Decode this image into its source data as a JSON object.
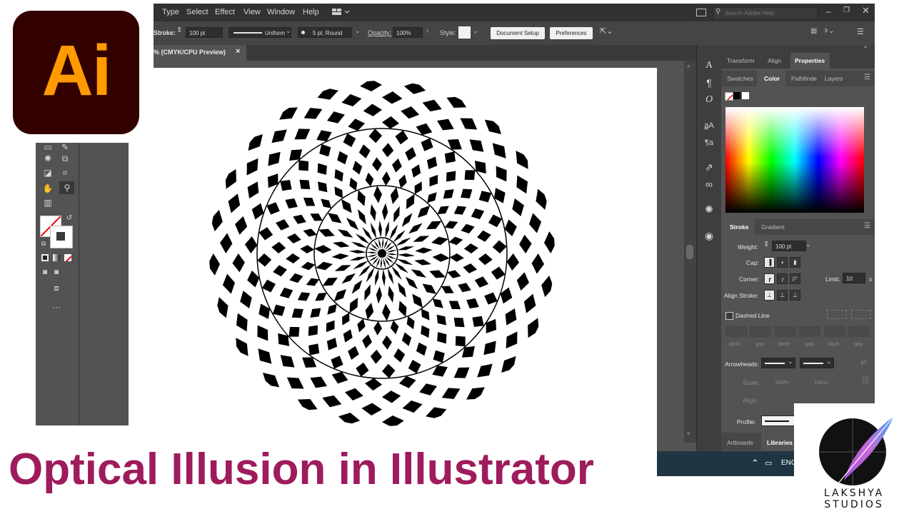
{
  "menu": [
    "Type",
    "Select",
    "Effect",
    "View",
    "Window",
    "Help"
  ],
  "search": {
    "placeholder": "Search Adobe Help"
  },
  "control_bar": {
    "stroke_label": "Stroke:",
    "stroke_value": "100 pt",
    "stroke_profile": "Uniform",
    "brush": "5 pt. Round",
    "opacity_label": "Opacity:",
    "opacity_value": "100%",
    "style_label": "Style:",
    "document_setup": "Document Setup",
    "preferences": "Preferences"
  },
  "document_tab": {
    "title": "% (CMYK/CPU Preview)",
    "close": "×"
  },
  "panel_tabs_top": [
    {
      "label": "Transform",
      "active": false
    },
    {
      "label": "Align",
      "active": false
    },
    {
      "label": "Properties",
      "active": true
    }
  ],
  "panel_tabs_color": [
    {
      "label": "Swatches",
      "active": false
    },
    {
      "label": "Color",
      "active": true
    },
    {
      "label": "Pathfinde",
      "active": false
    },
    {
      "label": "Layers",
      "active": false
    }
  ],
  "stroke_panel": {
    "tabs": [
      "Stroke",
      "Gradient"
    ],
    "weight_label": "Weight:",
    "weight_value": "100 pt",
    "cap_label": "Cap:",
    "corner_label": "Corner:",
    "limit_label": "Limit:",
    "limit_value": "10",
    "limit_unit": "x",
    "align_label": "Align Stroke:",
    "dashed_label": "Dashed Line",
    "dash_labels": [
      "dash",
      "gap",
      "dash",
      "gap",
      "dash",
      "gap"
    ],
    "arrowheads_label": "Arrowheads:",
    "scale_label": "Scale:",
    "scale_values": [
      "100%",
      "100%"
    ],
    "align_arrow_label": "Align:",
    "profile_label": "Profile:"
  },
  "bottom_tabs": [
    "Artboards",
    "Libraries"
  ],
  "taskbar": {
    "lang": "ENG"
  },
  "logo_text": "Ai",
  "title_text": "Optical Illusion in Illustrator",
  "studio_name": "LAKSHYA STUDIOS",
  "colors": {
    "accent_title": "#9e1b5c",
    "ai_orange": "#ff9a00",
    "ai_bg": "#330000",
    "ui_dark": "#535353"
  },
  "icons": [
    "search-icon",
    "minimize-icon",
    "restore-icon",
    "close-icon",
    "workspace-icon",
    "hand-icon",
    "zoom-icon",
    "type-icon",
    "paragraph-icon",
    "opentype-icon",
    "link-icon",
    "appearance-icon",
    "pathfinder-icon"
  ]
}
